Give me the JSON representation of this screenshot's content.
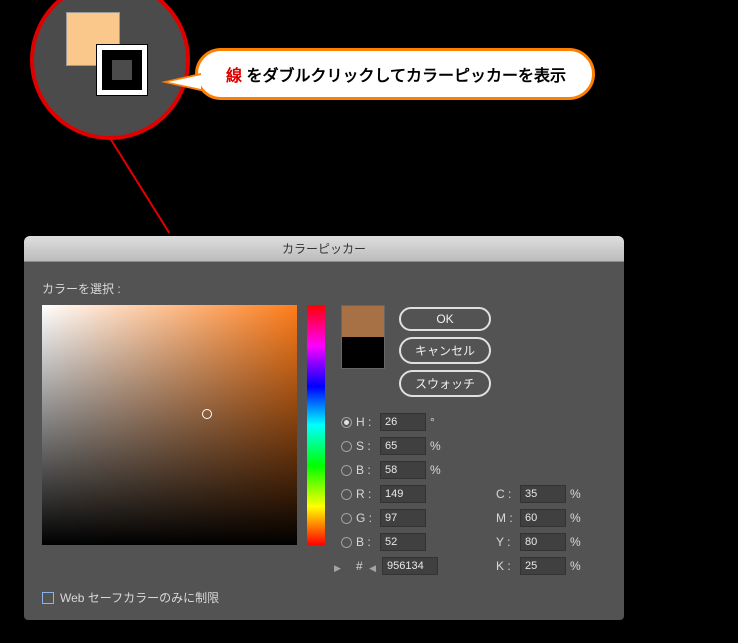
{
  "callout": {
    "highlight_word": "線",
    "rest_text": " をダブルクリックしてカラーピッカーを表示"
  },
  "swatches": {
    "fill_color": "#fbc88b",
    "stroke_color": "#000000"
  },
  "dialog": {
    "title": "カラーピッカー",
    "select_label": "カラーを選択 :",
    "buttons": {
      "ok": "OK",
      "cancel": "キャンセル",
      "swatches": "スウォッチ"
    },
    "hsb": {
      "h_label": "H :",
      "h_value": "26",
      "h_unit": "°",
      "s_label": "S :",
      "s_value": "65",
      "s_unit": "%",
      "b_label": "B :",
      "b_value": "58",
      "b_unit": "%"
    },
    "rgb": {
      "r_label": "R :",
      "r_value": "149",
      "g_label": "G :",
      "g_value": "97",
      "b_label": "B :",
      "b_value": "52"
    },
    "cmyk": {
      "c_label": "C :",
      "c_value": "35",
      "c_unit": "%",
      "m_label": "M :",
      "m_value": "60",
      "m_unit": "%",
      "y_label": "Y :",
      "y_value": "80",
      "y_unit": "%",
      "k_label": "K :",
      "k_value": "25",
      "k_unit": "%"
    },
    "hex": {
      "label": "#",
      "value": "956134"
    },
    "web_safe_label": "Web セーフカラーのみに制限",
    "selected_radio": "H"
  }
}
